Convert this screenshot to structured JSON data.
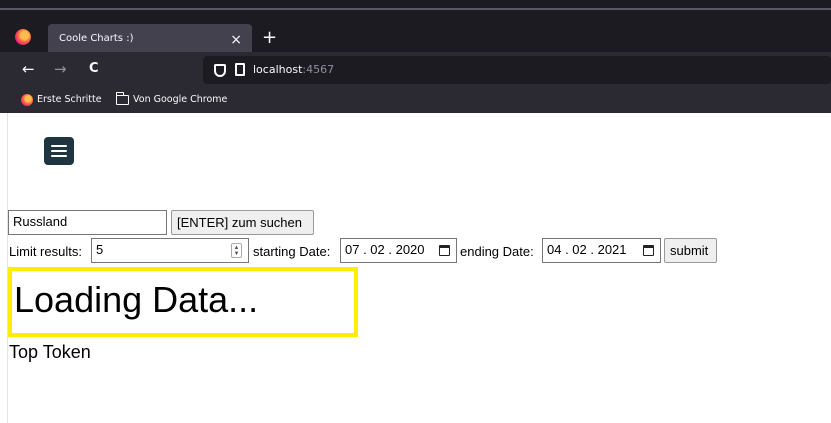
{
  "browser": {
    "tab_title": "Coole Charts :)",
    "tab_close": "×",
    "new_tab": "+",
    "back": "←",
    "forward": "→",
    "reload": "C",
    "url_host": "localhost",
    "url_port": ":4567",
    "bookmarks": [
      "Erste Schritte",
      "Von Google Chrome"
    ]
  },
  "page": {
    "search": {
      "value": "Russland",
      "button_label": "[ENTER] zum suchen"
    },
    "filters": {
      "limit_label": "Limit results:",
      "limit_value": "5",
      "start_label": "starting Date:",
      "start_value": "07 . 02 . 2020",
      "end_label": "ending Date:",
      "end_value": "04 . 02 . 2021",
      "submit_label": "submit"
    },
    "loading_text": "Loading Data...",
    "top_token_label": "Top Token",
    "highlight_color": "#ffee00",
    "menu_button_color": "#1f3540"
  }
}
